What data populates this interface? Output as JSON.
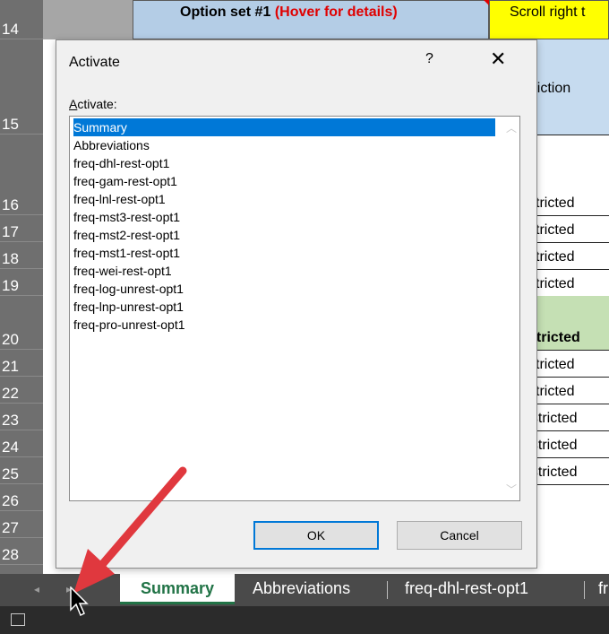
{
  "header": {
    "option_set_label": "Option set #1",
    "hover_text": "(Hover for details)",
    "scroll_text": "Scroll right t"
  },
  "rows": [
    "14",
    "15",
    "16",
    "17",
    "18",
    "19",
    "20",
    "21",
    "22",
    "23",
    "24",
    "25",
    "26",
    "27",
    "28"
  ],
  "background_column": {
    "r15": "triction",
    "r16": "stricted",
    "r17": "stricted",
    "r18": "stricted",
    "r19": "stricted",
    "r20": "stricted",
    "r21": "stricted",
    "r22": "stricted",
    "r23": "estricted",
    "r24": "estricted",
    "r25": "estricted"
  },
  "dialog": {
    "title": "Activate",
    "help": "?",
    "close": "✕",
    "label_underlined": "A",
    "label_rest": "ctivate:",
    "items": [
      "Summary",
      "Abbreviations",
      "freq-dhl-rest-opt1",
      "freq-gam-rest-opt1",
      "freq-lnl-rest-opt1",
      "freq-mst3-rest-opt1",
      "freq-mst2-rest-opt1",
      "freq-mst1-rest-opt1",
      "freq-wei-rest-opt1",
      "freq-log-unrest-opt1",
      "freq-lnp-unrest-opt1",
      "freq-pro-unrest-opt1"
    ],
    "selected_index": 0,
    "ok_label": "OK",
    "cancel_label": "Cancel"
  },
  "tabs": {
    "active": "Summary",
    "others": [
      "Abbreviations",
      "freq-dhl-rest-opt1",
      "fr"
    ]
  },
  "icons": {
    "scroll_left": "◂",
    "scroll_right": "▸",
    "list_up": "︿",
    "list_down": "﹀"
  },
  "colors": {
    "accent_blue": "#0078d7",
    "excel_green": "#217346",
    "arrow_red": "#e0383e"
  }
}
